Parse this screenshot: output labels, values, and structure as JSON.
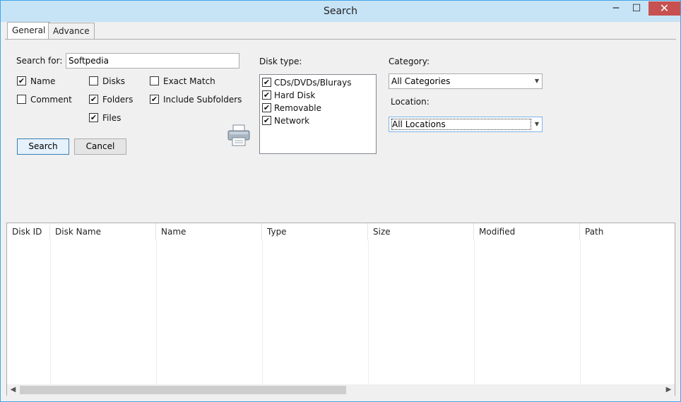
{
  "window": {
    "title": "Search",
    "minimize": "─",
    "maximize": "☐",
    "close": "✕"
  },
  "tabs": [
    {
      "label": "General",
      "active": true
    },
    {
      "label": "Advance",
      "active": false
    }
  ],
  "general": {
    "search_for_label": "Search for:",
    "search_value": "Softpedia",
    "checkboxes": [
      {
        "label": "Name",
        "checked": true
      },
      {
        "label": "Comment",
        "checked": false
      },
      {
        "label": "Disks",
        "checked": false
      },
      {
        "label": "Folders",
        "checked": true
      },
      {
        "label": "Files",
        "checked": true
      },
      {
        "label": "Exact Match",
        "checked": false
      },
      {
        "label": "Include Subfolders",
        "checked": true
      }
    ],
    "search_button": "Search",
    "cancel_button": "Cancel",
    "print_icon": "printer-icon",
    "disk_type_label": "Disk type:",
    "disk_types": [
      {
        "label": "CDs/DVDs/Blurays",
        "checked": true
      },
      {
        "label": "Hard Disk",
        "checked": true
      },
      {
        "label": "Removable",
        "checked": true
      },
      {
        "label": "Network",
        "checked": true
      }
    ],
    "category_label": "Category:",
    "category_value": "All Categories",
    "location_label": "Location:",
    "location_value": "All Locations"
  },
  "results": {
    "columns": [
      "Disk ID",
      "Disk Name",
      "Name",
      "Type",
      "Size",
      "Modified",
      "Path"
    ],
    "rows": []
  },
  "scrollbar": {
    "left_arrow": "◀",
    "right_arrow": "▶"
  },
  "check_glyph": "✔"
}
